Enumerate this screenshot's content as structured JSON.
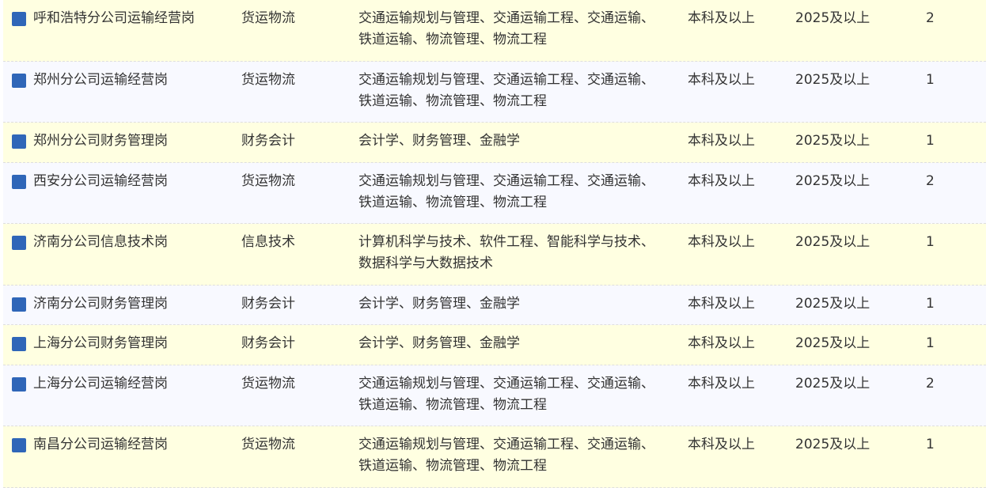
{
  "colors": {
    "row_yellow": "#ffffe1",
    "row_blue": "#f8f9ff",
    "bullet": "#2f66b8",
    "text": "#333333",
    "divider": "#dedede"
  },
  "rows": [
    {
      "name": "呼和浩特分公司运输经营岗",
      "category": "货运物流",
      "major": "交通运输规划与管理、交通运输工程、交通运输、铁道运输、物流管理、物流工程",
      "education": "本科及以上",
      "year": "2025及以上",
      "count": "2",
      "bg": "yellow",
      "lines": 2
    },
    {
      "name": "郑州分公司运输经营岗",
      "category": "货运物流",
      "major": "交通运输规划与管理、交通运输工程、交通运输、铁道运输、物流管理、物流工程",
      "education": "本科及以上",
      "year": "2025及以上",
      "count": "1",
      "bg": "blue",
      "lines": 2
    },
    {
      "name": "郑州分公司财务管理岗",
      "category": "财务会计",
      "major": "会计学、财务管理、金融学",
      "education": "本科及以上",
      "year": "2025及以上",
      "count": "1",
      "bg": "yellow",
      "lines": 1
    },
    {
      "name": "西安分公司运输经营岗",
      "category": "货运物流",
      "major": "交通运输规划与管理、交通运输工程、交通运输、铁道运输、物流管理、物流工程",
      "education": "本科及以上",
      "year": "2025及以上",
      "count": "2",
      "bg": "blue",
      "lines": 2
    },
    {
      "name": "济南分公司信息技术岗",
      "category": "信息技术",
      "major": "计算机科学与技术、软件工程、智能科学与技术、数据科学与大数据技术",
      "education": "本科及以上",
      "year": "2025及以上",
      "count": "1",
      "bg": "yellow",
      "lines": 2
    },
    {
      "name": "济南分公司财务管理岗",
      "category": "财务会计",
      "major": "会计学、财务管理、金融学",
      "education": "本科及以上",
      "year": "2025及以上",
      "count": "1",
      "bg": "blue",
      "lines": 1
    },
    {
      "name": "上海分公司财务管理岗",
      "category": "财务会计",
      "major": "会计学、财务管理、金融学",
      "education": "本科及以上",
      "year": "2025及以上",
      "count": "1",
      "bg": "yellow",
      "lines": 1
    },
    {
      "name": "上海分公司运输经营岗",
      "category": "货运物流",
      "major": "交通运输规划与管理、交通运输工程、交通运输、铁道运输、物流管理、物流工程",
      "education": "本科及以上",
      "year": "2025及以上",
      "count": "2",
      "bg": "blue",
      "lines": 2
    },
    {
      "name": "南昌分公司运输经营岗",
      "category": "货运物流",
      "major": "交通运输规划与管理、交通运输工程、交通运输、铁道运输、物流管理、物流工程",
      "education": "本科及以上",
      "year": "2025及以上",
      "count": "1",
      "bg": "yellow",
      "lines": 2
    }
  ]
}
